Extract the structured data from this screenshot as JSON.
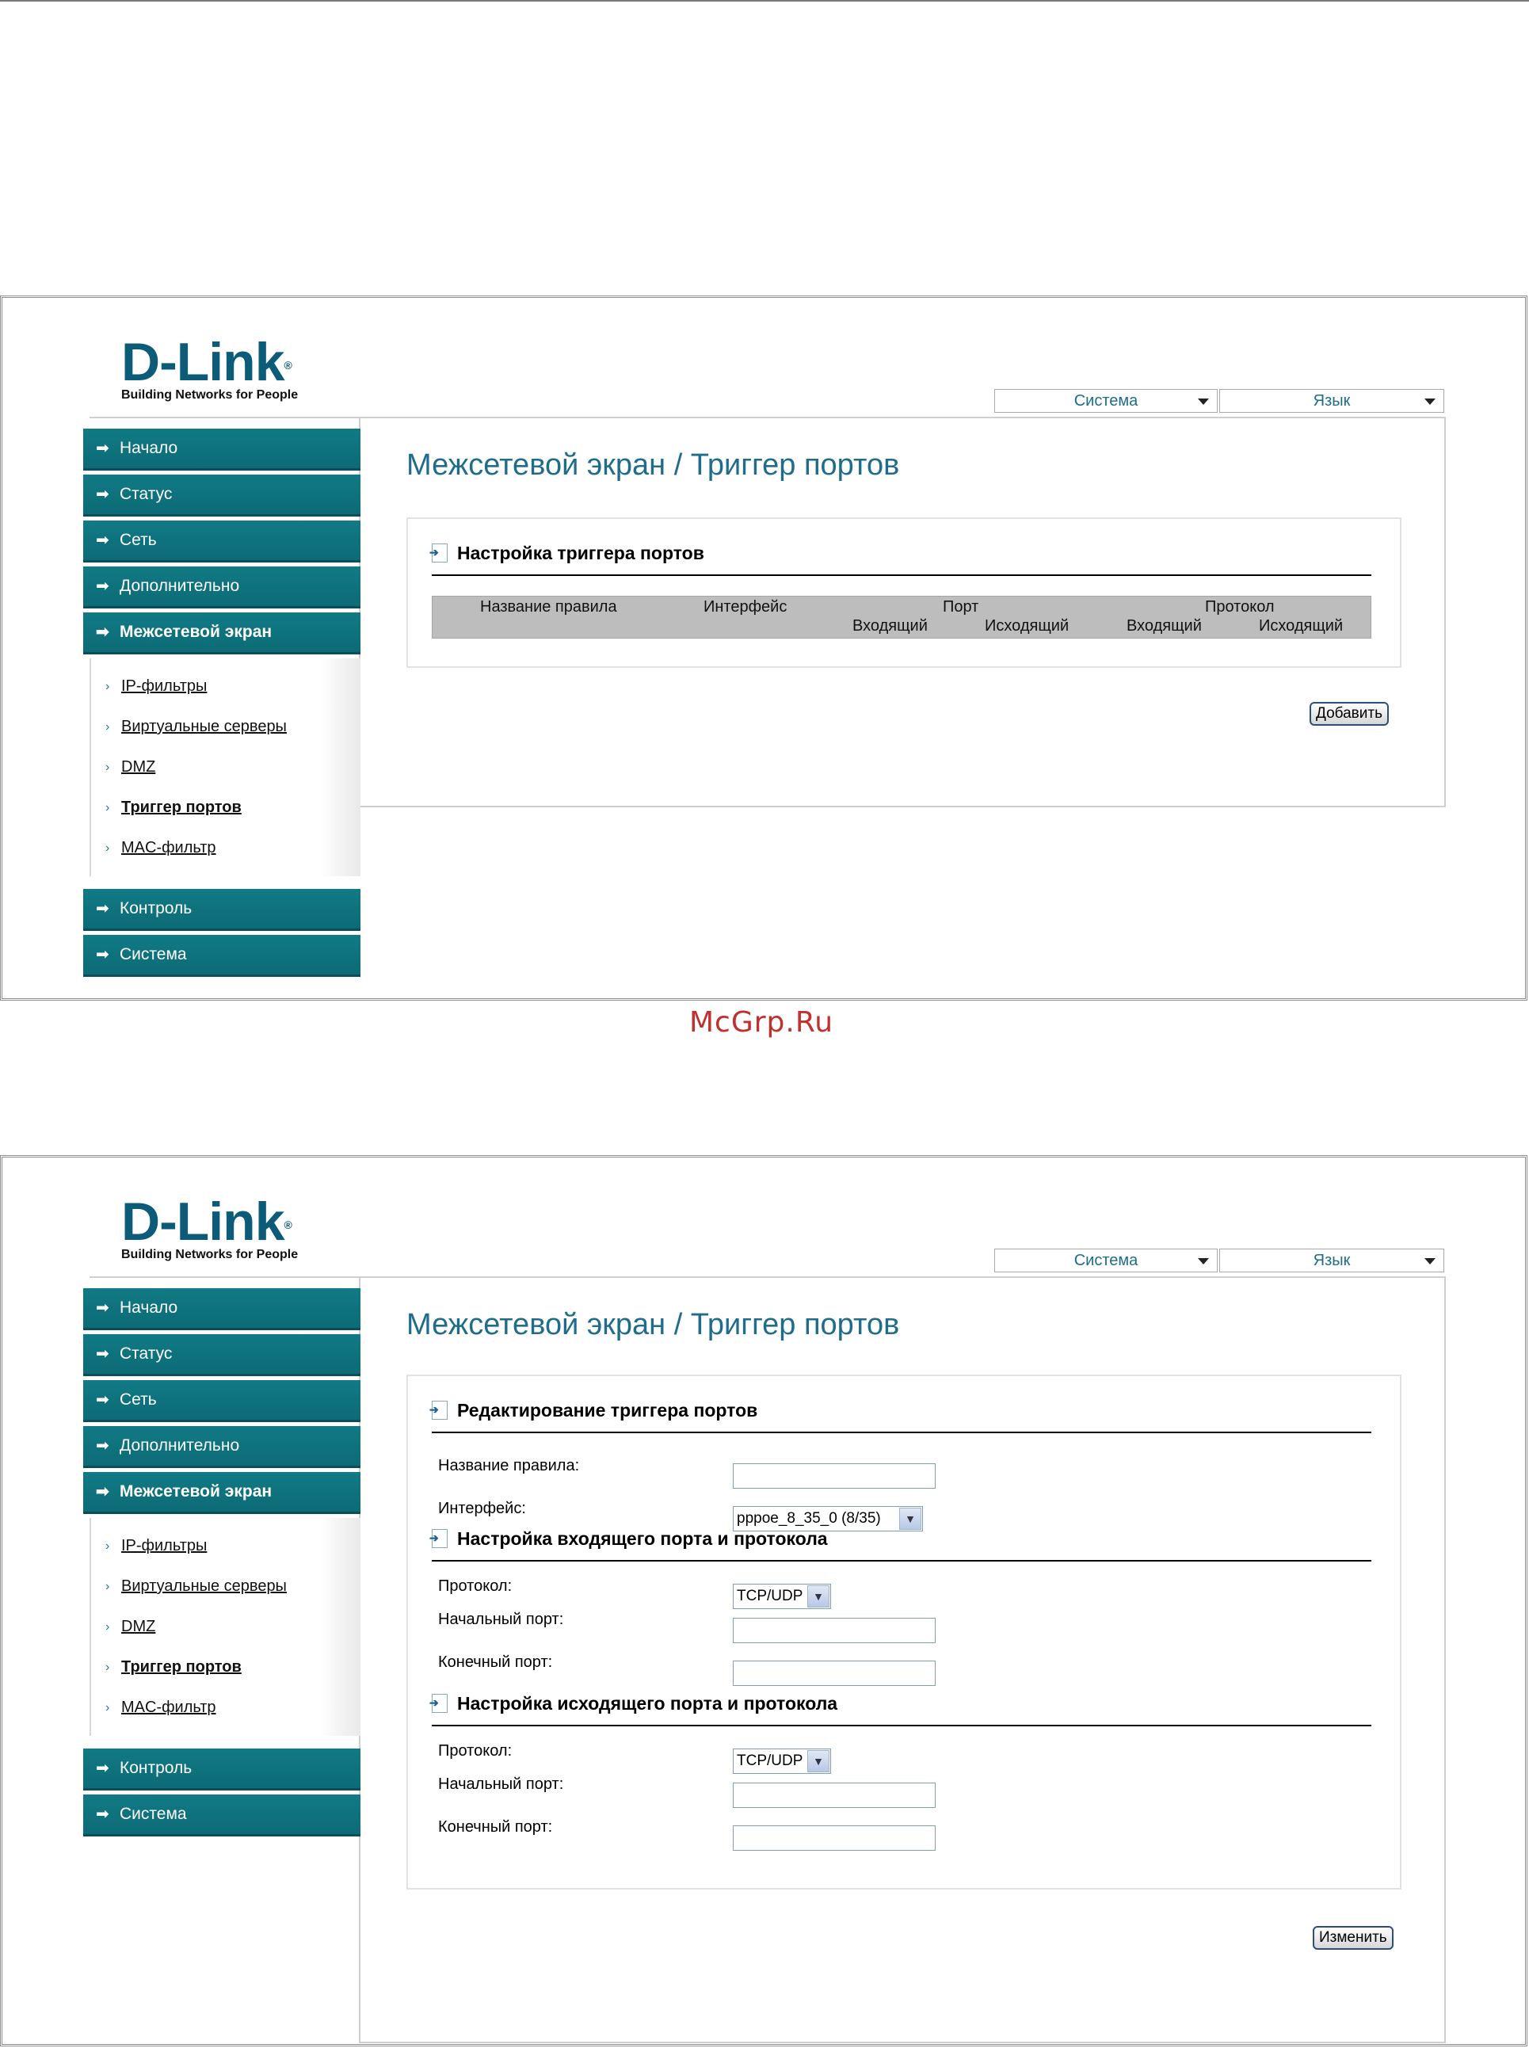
{
  "brand": {
    "name": "D-Link",
    "reg": "®",
    "tagline": "Building Networks for People"
  },
  "top_selects": {
    "system": "Система",
    "language": "Язык"
  },
  "menu": {
    "items": [
      "Начало",
      "Статус",
      "Сеть",
      "Дополнительно",
      "Межсетевой экран",
      "Контроль",
      "Система"
    ],
    "submenu": [
      "IP-фильтры",
      "Виртуальные серверы",
      "DMZ",
      "Триггер портов",
      "MAC-фильтр"
    ]
  },
  "page_title": "Межсетевой экран / Триггер портов",
  "screen1": {
    "section_title": "Настройка триггера портов",
    "table_headers": {
      "rule_name": "Название правила",
      "interface": "Интерфейс",
      "port": "Порт",
      "protocol": "Протокол",
      "incoming": "Входящий",
      "outgoing": "Исходящий"
    },
    "add_button": "Добавить"
  },
  "watermark": "McGrp.Ru",
  "screen2": {
    "section_edit": "Редактирование триггера портов",
    "rule_name_label": "Название правила:",
    "interface_label": "Интерфейс:",
    "interface_value": "pppoe_8_35_0 (8/35)",
    "section_in": "Настройка входящего порта и протокола",
    "section_out": "Настройка исходящего порта и протокола",
    "protocol_label": "Протокол:",
    "protocol_value": "TCP/UDP",
    "start_port_label": "Начальный порт:",
    "end_port_label": "Конечный порт:",
    "change_button": "Изменить"
  }
}
